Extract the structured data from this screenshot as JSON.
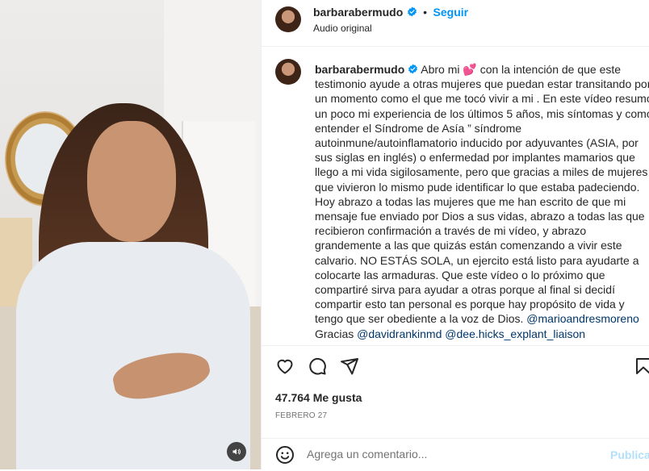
{
  "video": {
    "audio_icon": "speaker-icon"
  },
  "header": {
    "username": "barbarabermudo",
    "separator": "•",
    "follow_label": "Seguir",
    "audio_label": "Audio original",
    "verified_icon": "verified-badge-icon"
  },
  "caption": {
    "username": "barbarabermudo",
    "intro": "Abro mi",
    "heart_emoji": "💕",
    "body": "con la intención de que este testimonio ayude a otras mujeres que puedan estar transitando por un momento como el que me tocó vivir a mi . En este vídeo resumo un poco mi experiencia de los últimos 5 años, mis síntomas y como entender el Síndrome de Asía ” síndrome autoinmune/autoinflamatorio inducido por adyuvantes (ASIA, por sus siglas en inglés) o enfermedad por implantes mamarios que llego a mi vida sigilosamente, pero que gracias a miles de mujeres que vivieron lo mismo pude identificar lo que estaba padeciendo. Hoy abrazo a todas las mujeres que me han escrito de que mi mensaje fue enviado por Dios a sus vidas, abrazo a todas las que recibieron confirmación a través de mi vídeo, y abrazo grandemente a las que quizás están comenzando a vivir este calvario. NO ESTÁS SOLA, un ejercito está listo para ayudarte a colocarte las armaduras. Que este vídeo o lo próximo que compartiré sirva para ayudar a otras porque al final si decidí compartir esto tan personal es porque hay propósito de vida y tengo que ser obediente a la voz de Dios.",
    "mention_1": "@marioandresmoreno",
    "thanks": "Gracias",
    "mention_2": "@davidrankinmd",
    "mention_3": "@dee.hicks_explant_liaison"
  },
  "actions": {
    "like_icon": "heart-icon",
    "comment_icon": "comment-icon",
    "share_icon": "share-icon",
    "save_icon": "bookmark-icon",
    "likes": "47.764 Me gusta",
    "date": "FEBRERO 27"
  },
  "comment": {
    "emoji_icon": "emoji-icon",
    "placeholder": "Agrega un comentario...",
    "publish_label": "Publicar"
  },
  "colors": {
    "accent": "#0095f6",
    "mention": "#00376b",
    "publish_disabled": "#b2dffc",
    "text": "#262626",
    "muted": "#737373"
  }
}
